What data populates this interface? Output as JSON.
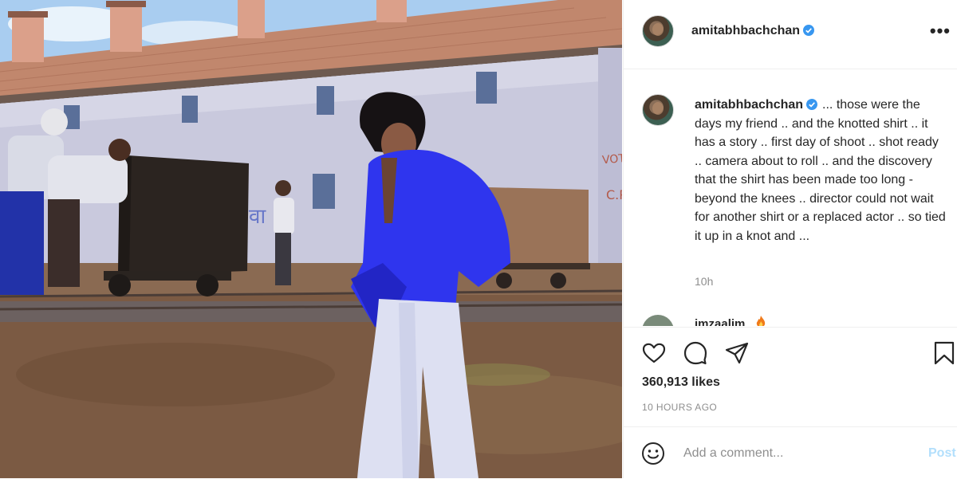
{
  "colors": {
    "verified": "#3897f0",
    "text_primary": "#262626",
    "text_secondary": "#8e8e8e",
    "post_disabled": "#b2dffc",
    "divider": "#efefef"
  },
  "header": {
    "username": "amitabhbachchan",
    "verified_icon": "verified-badge-icon",
    "more_label": "•••"
  },
  "caption": {
    "username": "amitabhbachchan",
    "text": "... those were the days my friend .. and the knotted shirt .. it has a story .. first day of shoot .. shot ready .. camera about to roll .. and the discovery that the shirt has been made too long - beyond the knees .. director could not wait for another shirt or a replaced actor .. so tied it up in a knot and ...",
    "time": "10h"
  },
  "next_comment": {
    "username": "imzaalim"
  },
  "actions": {
    "like_icon": "heart-icon",
    "comment_icon": "comment-icon",
    "share_icon": "share-icon",
    "save_icon": "bookmark-icon"
  },
  "likes": "360,913 likes",
  "posted_ago": "10 HOURS AGO",
  "comment": {
    "placeholder": "Add a comment...",
    "post_label": "Post",
    "emoji_icon": "smiley-icon"
  }
}
